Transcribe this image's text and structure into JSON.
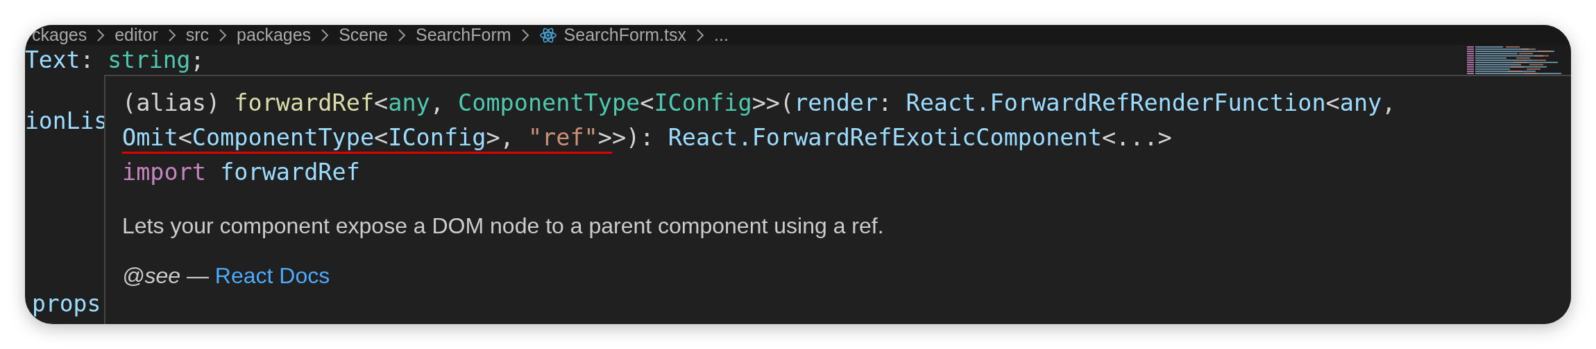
{
  "breadcrumb": [
    {
      "kind": "folder",
      "label": "ckages"
    },
    {
      "kind": "folder",
      "label": "editor"
    },
    {
      "kind": "folder",
      "label": "src"
    },
    {
      "kind": "folder",
      "label": "packages"
    },
    {
      "kind": "folder",
      "label": "Scene"
    },
    {
      "kind": "folder",
      "label": "SearchForm"
    },
    {
      "kind": "file",
      "label": "SearchForm.tsx"
    },
    {
      "kind": "more",
      "label": "..."
    }
  ],
  "editor": {
    "lines": [
      {
        "tokens": [
          {
            "text": "Text",
            "kind": "variable"
          },
          {
            "text": ": ",
            "kind": "plain"
          },
          {
            "text": "string",
            "kind": "type"
          },
          {
            "text": ";",
            "kind": "plain"
          }
        ]
      },
      {
        "tokens": [
          {
            "text": "ionLis",
            "kind": "variable"
          }
        ]
      },
      {
        "tokens": [
          {
            "text": "props",
            "kind": "variable"
          }
        ]
      }
    ]
  },
  "hover": {
    "signature": [
      {
        "segments": [
          {
            "underlined": false,
            "tokens": [
              {
                "text": "(alias) ",
                "kind": "plain"
              },
              {
                "text": "forwardRef",
                "kind": "function"
              },
              {
                "text": "<",
                "kind": "plain"
              },
              {
                "text": "any",
                "kind": "type"
              },
              {
                "text": ", ",
                "kind": "plain"
              },
              {
                "text": "ComponentType",
                "kind": "type"
              },
              {
                "text": "<",
                "kind": "plain"
              },
              {
                "text": "IConfig",
                "kind": "type"
              },
              {
                "text": ">>(",
                "kind": "plain"
              },
              {
                "text": "render",
                "kind": "variable"
              },
              {
                "text": ": ",
                "kind": "plain"
              },
              {
                "text": "React.ForwardRefRenderFunction",
                "kind": "variable"
              },
              {
                "text": "<",
                "kind": "plain"
              },
              {
                "text": "any",
                "kind": "variable"
              },
              {
                "text": ",",
                "kind": "plain"
              }
            ]
          }
        ]
      },
      {
        "segments": [
          {
            "underlined": true,
            "tokens": [
              {
                "text": "Omit",
                "kind": "variable"
              },
              {
                "text": "<",
                "kind": "plain"
              },
              {
                "text": "ComponentType",
                "kind": "variable"
              },
              {
                "text": "<",
                "kind": "plain"
              },
              {
                "text": "IConfig",
                "kind": "variable"
              },
              {
                "text": ">, ",
                "kind": "plain"
              },
              {
                "text": "\"ref\"",
                "kind": "string"
              },
              {
                "text": ">",
                "kind": "plain"
              }
            ]
          },
          {
            "underlined": false,
            "tokens": [
              {
                "text": ">): ",
                "kind": "plain"
              },
              {
                "text": "React.ForwardRefExoticComponent",
                "kind": "variable"
              },
              {
                "text": "<...>",
                "kind": "plain"
              }
            ]
          }
        ]
      },
      {
        "segments": [
          {
            "underlined": false,
            "tokens": [
              {
                "text": "import",
                "kind": "keyword"
              },
              {
                "text": " forwardRef",
                "kind": "variable"
              }
            ]
          }
        ]
      }
    ],
    "description": "Lets your component expose a DOM node to a parent component using a ref.",
    "see": {
      "text": "*@see* — ",
      "link": "React Docs"
    }
  }
}
